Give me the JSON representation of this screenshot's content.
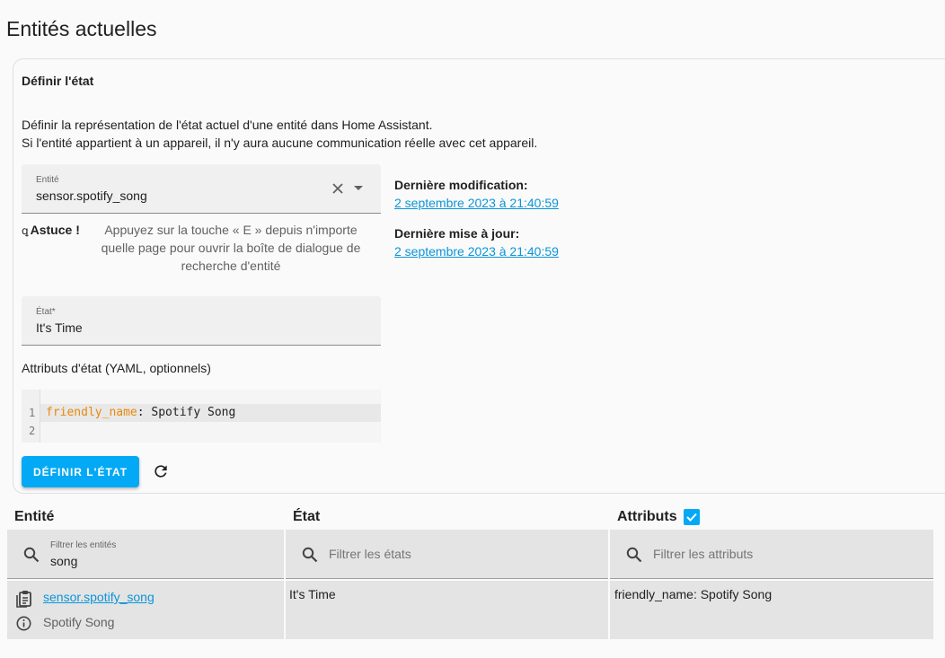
{
  "page_title": "Entités actuelles",
  "card": {
    "title": "Définir l'état",
    "description_line1": "Définir la représentation de l'état actuel d'une entité dans Home Assistant.",
    "description_line2": "Si l'entité appartient à un appareil, il n'y aura aucune communication réelle avec cet appareil.",
    "entity_field": {
      "label": "Entité",
      "value": "sensor.spotify_song"
    },
    "tip": {
      "icon": "lightbulb-icon",
      "label": "Astuce !",
      "text": "Appuyez sur la touche « E » depuis n'importe quelle page pour ouvrir la boîte de dialogue de recherche d'entité"
    },
    "state_field": {
      "label": "État*",
      "value": "It's Time"
    },
    "attributes_label": "Attributs d'état (YAML, optionnels)",
    "yaml_editor": {
      "line_numbers": [
        "1",
        "2"
      ],
      "key": "friendly_name",
      "separator": ": ",
      "value": "Spotify Song"
    },
    "set_button": "DÉFINIR L'ÉTAT",
    "last_changed_label": "Dernière modification:",
    "last_changed_value": "2 septembre 2023 à 21:40:59",
    "last_updated_label": "Dernière mise à jour:",
    "last_updated_value": "2 septembre 2023 à 21:40:59"
  },
  "table": {
    "headers": {
      "entity": "Entité",
      "state": "État",
      "attributes": "Attributs"
    },
    "attributes_checkbox_checked": true,
    "filters": {
      "entity": {
        "label": "Filtrer les entités",
        "value": "song"
      },
      "state": {
        "placeholder": "Filtrer les états"
      },
      "attributes": {
        "placeholder": "Filtrer les attributs"
      }
    },
    "rows": [
      {
        "entity_id": "sensor.spotify_song",
        "friendly_name": "Spotify Song",
        "state": "It's Time",
        "attributes": "friendly_name: Spotify Song"
      }
    ]
  },
  "colors": {
    "accent": "#03a9f4",
    "link": "#0b95d8",
    "yaml_key": "#e8890c"
  }
}
